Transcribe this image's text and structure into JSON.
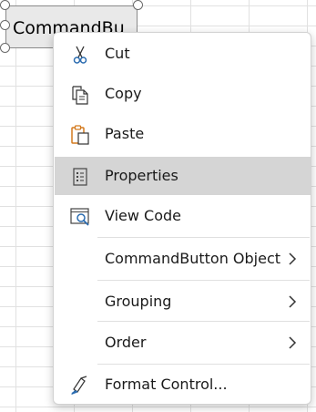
{
  "command_button": {
    "label": "CommandBu"
  },
  "menu": {
    "items": [
      {
        "label": "Cut",
        "icon": "scissors-icon"
      },
      {
        "label": "Copy",
        "icon": "copy-icon"
      },
      {
        "label": "Paste",
        "icon": "paste-icon"
      },
      {
        "label": "Properties",
        "icon": "properties-icon",
        "highlighted": true
      },
      {
        "label": "View Code",
        "icon": "view-code-icon"
      },
      {
        "label": "CommandButton Object",
        "has_submenu": true
      },
      {
        "label": "Grouping",
        "has_submenu": true
      },
      {
        "label": "Order",
        "has_submenu": true
      },
      {
        "label": "Format Control...",
        "icon": "format-control-icon"
      }
    ]
  },
  "colors": {
    "highlight": "#d5d5d5",
    "icon_blue": "#2b6cb0",
    "icon_orange": "#d47a1e"
  }
}
